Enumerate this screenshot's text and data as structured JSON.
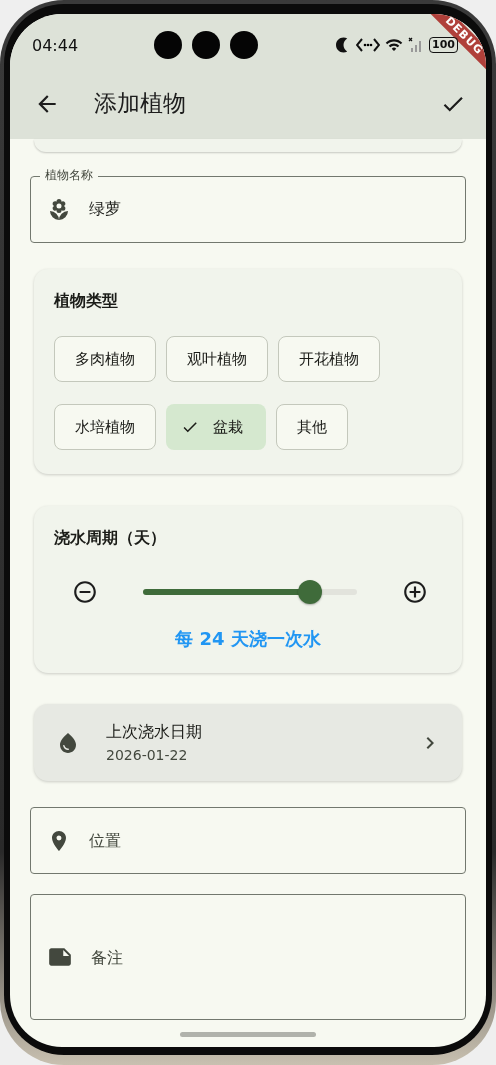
{
  "status_bar": {
    "time": "04:44",
    "battery": "100"
  },
  "debug_banner": "DEBUG",
  "app_bar": {
    "title": "添加植物"
  },
  "name_field": {
    "label": "植物名称",
    "value": "绿萝"
  },
  "type_card": {
    "title": "植物类型",
    "chips": [
      {
        "label": "多肉植物",
        "selected": false
      },
      {
        "label": "观叶植物",
        "selected": false
      },
      {
        "label": "开花植物",
        "selected": false
      },
      {
        "label": "水培植物",
        "selected": false
      },
      {
        "label": "盆栽",
        "selected": true
      },
      {
        "label": "其他",
        "selected": false
      }
    ]
  },
  "watering_card": {
    "title": "浇水周期（天）",
    "slider": {
      "level": 0.78
    },
    "summary": "每 24 天浇一次水"
  },
  "last_watered": {
    "title": "上次浇水日期",
    "date": "2026-01-22"
  },
  "location_field": {
    "placeholder": "位置"
  },
  "notes_field": {
    "placeholder": "备注"
  }
}
